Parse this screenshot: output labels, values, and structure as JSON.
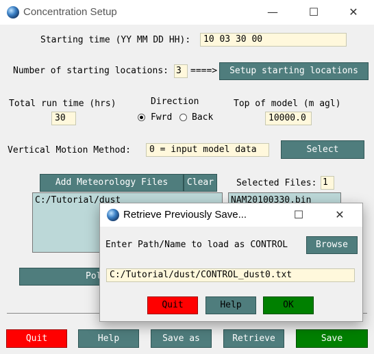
{
  "window": {
    "title": "Concentration Setup",
    "controls": {
      "minimize": "—",
      "maximize": "☐",
      "close": "✕"
    }
  },
  "starting_time": {
    "label": "Starting time (YY MM DD HH):",
    "value": "10 03 30 00"
  },
  "locations": {
    "label": "Number of starting locations:",
    "value": "3",
    "arrow": "====>",
    "button": "Setup starting locations"
  },
  "run_time": {
    "label": "Total run time (hrs)",
    "value": "30"
  },
  "direction": {
    "label": "Direction",
    "forward": "Fwrd",
    "back": "Back",
    "selected": "Fwrd"
  },
  "top_model": {
    "label": "Top of model (m agl)",
    "value": "10000.0"
  },
  "vertical": {
    "label": "Vertical Motion Method:",
    "value": "0 = input model data",
    "button": "Select"
  },
  "met": {
    "add_button": "Add Meteorology Files",
    "clear_button": "Clear",
    "selected_label": "Selected Files:",
    "selected_count": "1",
    "dirs": [
      "C:/Tutorial/dust"
    ],
    "files": [
      "NAM20100330.bin"
    ]
  },
  "pollutant_button": "Pol",
  "bottom": {
    "quit": "Quit",
    "help": "Help",
    "save_as": "Save as",
    "retrieve": "Retrieve",
    "save": "Save"
  },
  "colors": {
    "teal_button": "#4f7d7d",
    "quit_red": "#ff0000",
    "save_green": "#008000",
    "entry_bg": "#fff8dc",
    "list_bg": "#bcd8d8"
  },
  "dialog": {
    "title": "Retrieve Previously Save...",
    "prompt": "Enter Path/Name to load as CONTROL",
    "browse": "Browse",
    "path": "C:/Tutorial/dust/CONTROL_dust0.txt",
    "quit": "Quit",
    "help": "Help",
    "ok": "OK",
    "controls": {
      "maximize": "☐",
      "close": "✕"
    }
  }
}
